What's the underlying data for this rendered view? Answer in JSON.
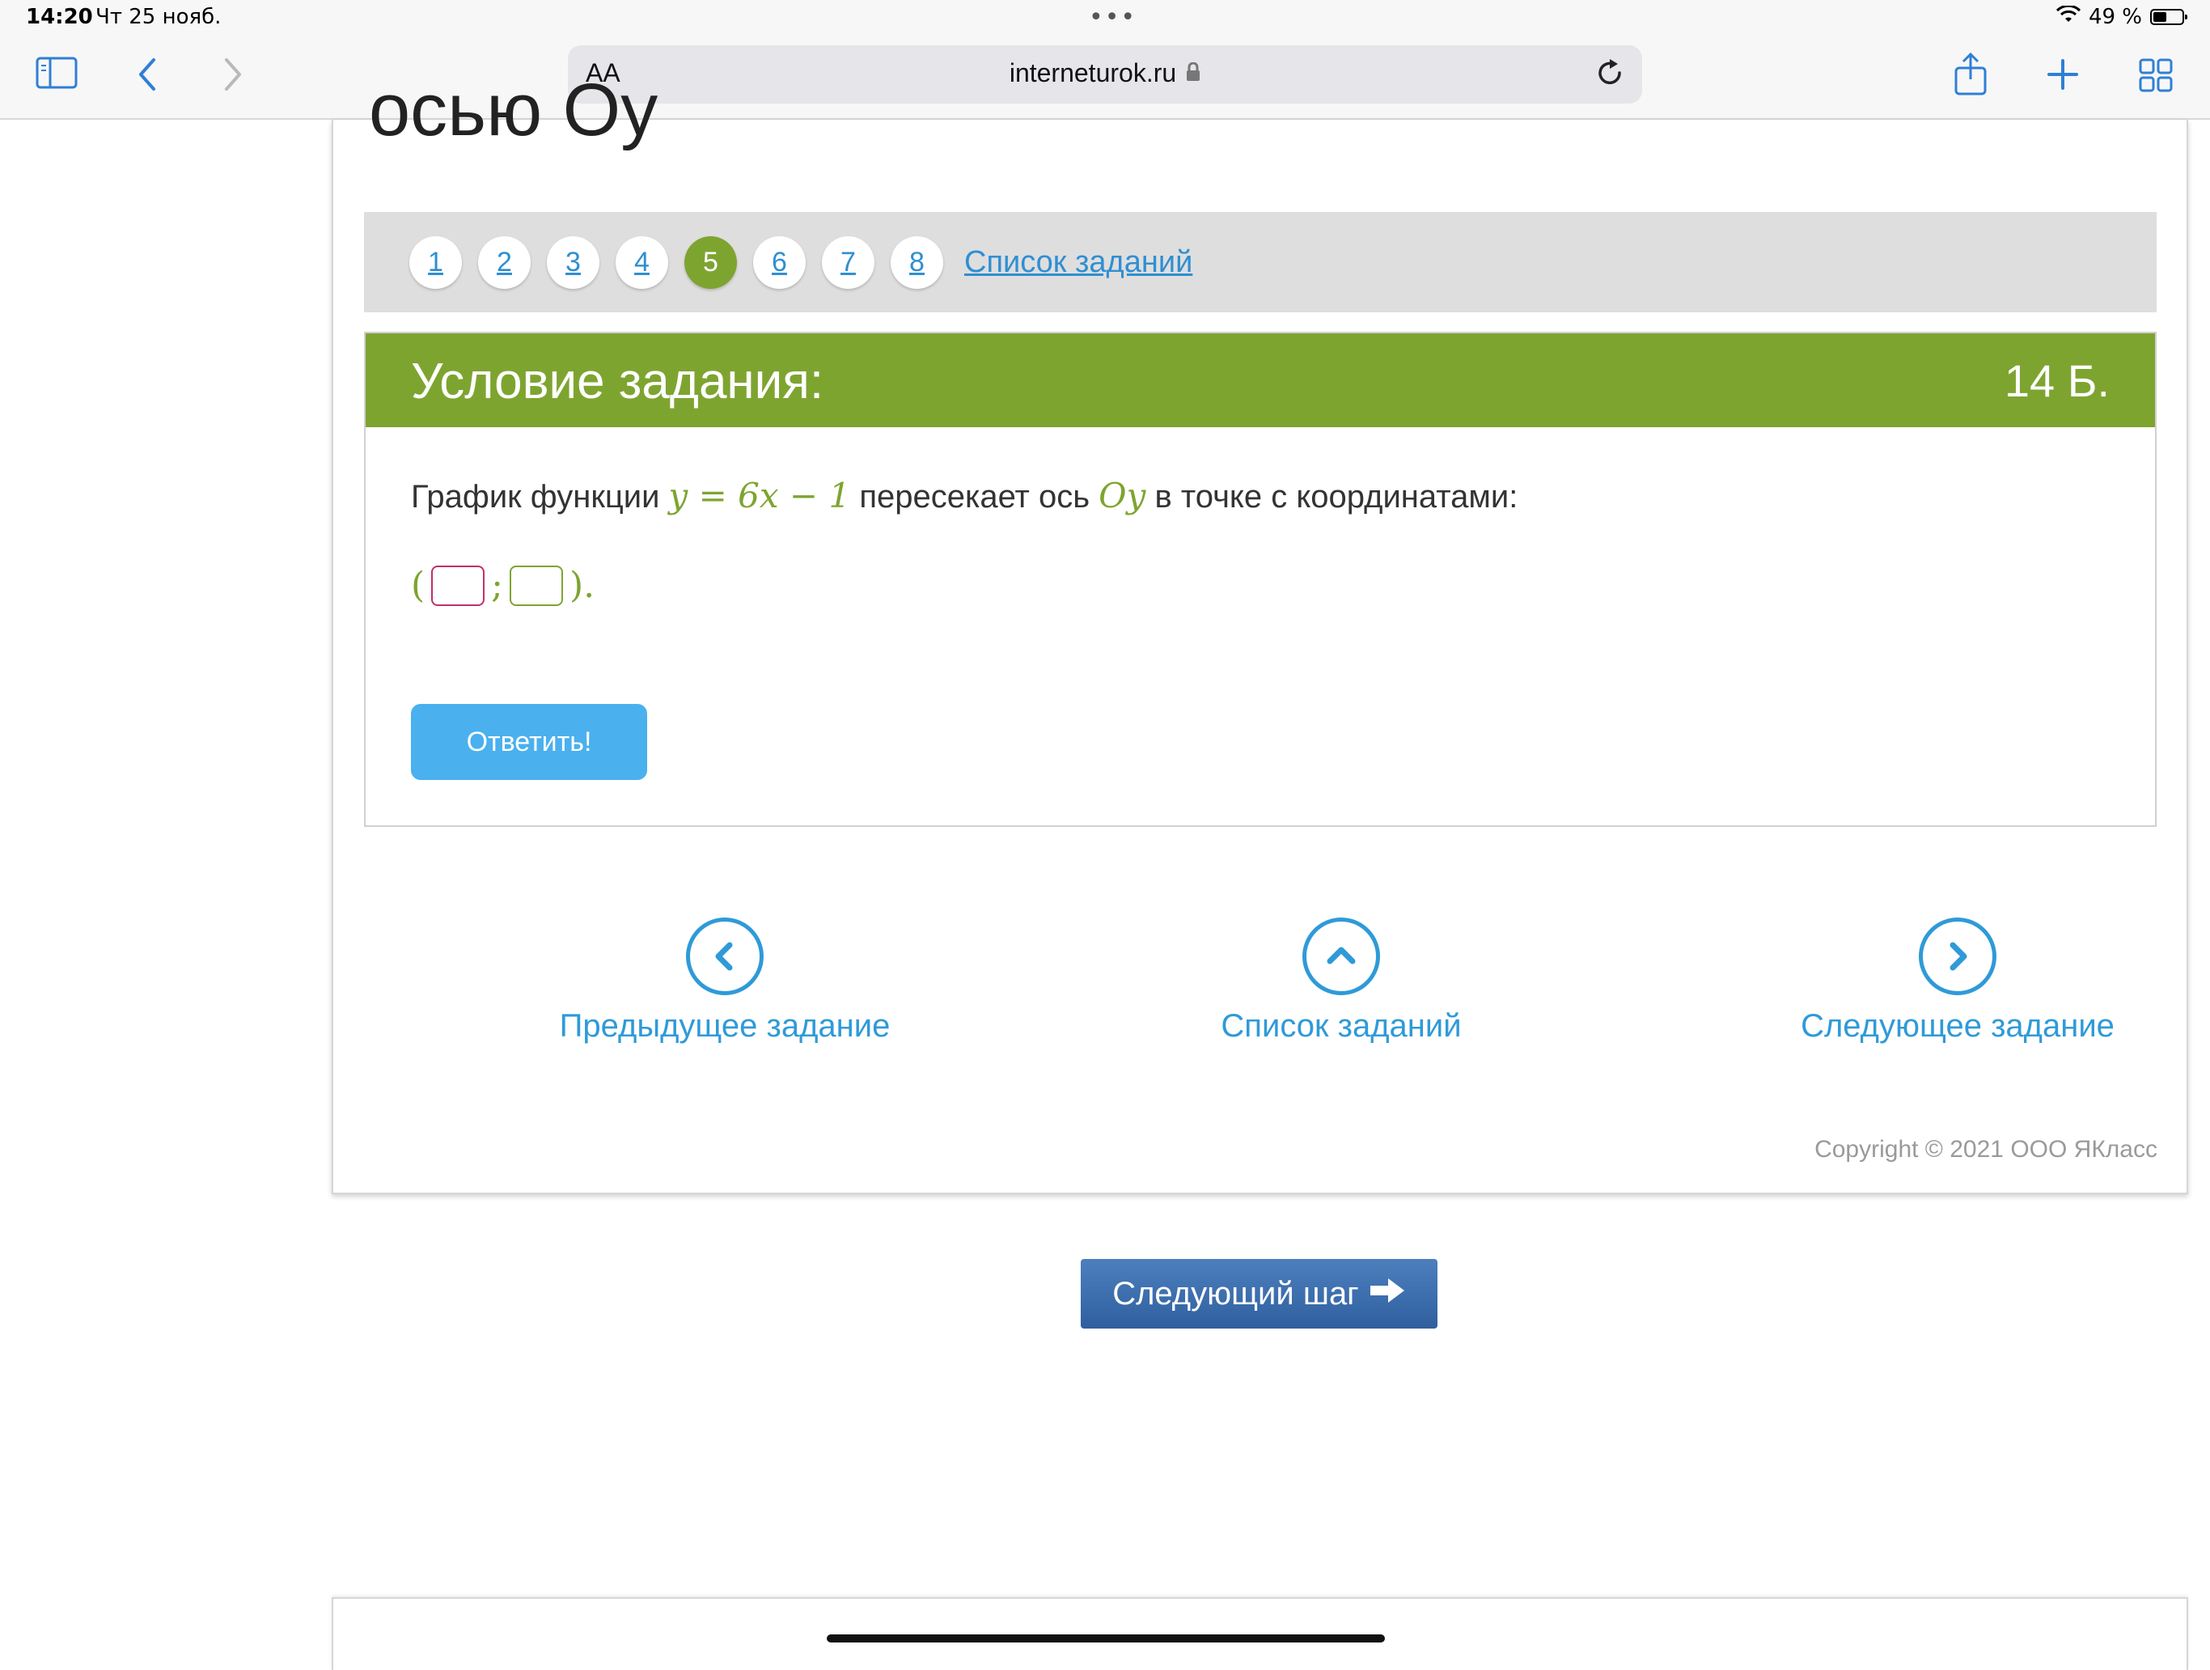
{
  "status_bar": {
    "time": "14:20",
    "date": "Чт 25 нояб.",
    "dots": "•••",
    "battery": "49 %",
    "battery_level": 0.49
  },
  "browser": {
    "text_size": "AA",
    "url": "interneturok.ru",
    "icons": [
      "sidebar-icon",
      "back-icon",
      "forward-icon",
      "lock-icon",
      "reload-icon",
      "share-icon",
      "new-tab-icon",
      "tabs-icon"
    ]
  },
  "page": {
    "cut_title": "осью Oy",
    "pager": {
      "pages": [
        "1",
        "2",
        "3",
        "4",
        "5",
        "6",
        "7",
        "8"
      ],
      "active": "5",
      "list_link": "Список заданий"
    },
    "task": {
      "header": "Условие задания:",
      "points": "14 Б.",
      "text_before": "График функции",
      "formula": "y = 6x − 1",
      "text_middle": "пересекает ось",
      "axis": "Oy",
      "text_after": "в точке с координатами:",
      "open_paren": "(",
      "separator": ";",
      "close_paren": ").",
      "inputs": [
        {
          "value": "",
          "color": "#c0306a"
        },
        {
          "value": "",
          "color": "#7ea430"
        }
      ],
      "answer_button": "Ответить!"
    },
    "bottom_nav": {
      "prev": "Предыдущее задание",
      "list": "Список заданий",
      "next": "Следующее задание"
    },
    "copyright": "Copyright © 2021 ООО ЯКласс",
    "next_step_button": "Следующий шаг"
  },
  "colors": {
    "accent_green": "#7ea430",
    "link_blue": "#2f8fd2",
    "answer_button": "#4ab0ee",
    "next_step_button": "#3b6aab"
  }
}
